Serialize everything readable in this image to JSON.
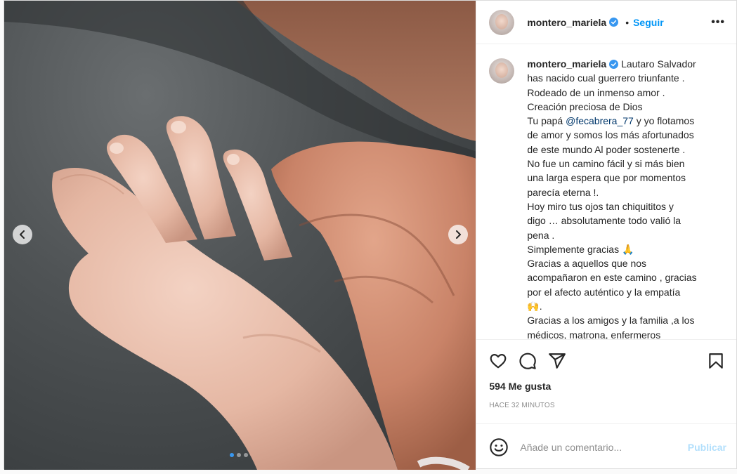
{
  "post": {
    "username": "montero_mariela",
    "separator": "•",
    "follow_label": "Seguir",
    "more_label": "•••",
    "caption_lines": [
      "Lautaro Salvador",
      "has nacido cual guerrero triunfante .",
      "Rodeado de un inmenso amor .",
      "Creación preciosa de Dios",
      "Tu papá",
      "@fecabrera_77",
      "y yo flotamos",
      "de amor y somos los más afortunados",
      "de este mundo Al poder sostenerte .",
      "No fue un camino fácil y si más bien",
      "una larga espera que por momentos",
      "parecía eterna !.",
      "Hoy miro tus ojos tan chiquititos y",
      "digo … absolutamente todo valió la",
      "pena .",
      "Simplemente gracias 🙏",
      "Gracias a aquellos que nos",
      "acompañaron en este camino , gracias",
      "por el afecto auténtico y la empatía",
      "🙌.",
      "Gracias a los amigos y la familia ,a los",
      "médicos, matrona, enfermeros"
    ],
    "likes": "594 Me gusta",
    "time": "HACE 32 MINUTOS",
    "comment_placeholder": "Añade un comentario...",
    "publish_label": "Publicar",
    "carousel": {
      "slide_count": 3,
      "active_index": 0
    }
  },
  "icons": {
    "like": "heart-icon",
    "comment": "comment-icon",
    "share": "share-icon",
    "save": "bookmark-icon",
    "emoji": "emoji-icon",
    "verified": "verified-badge-icon",
    "prev": "chevron-left-icon",
    "next": "chevron-right-icon"
  },
  "colors": {
    "link": "#0095f6",
    "mention": "#00376b",
    "muted": "#8e8e8e",
    "publish_disabled": "#b2dffc"
  }
}
